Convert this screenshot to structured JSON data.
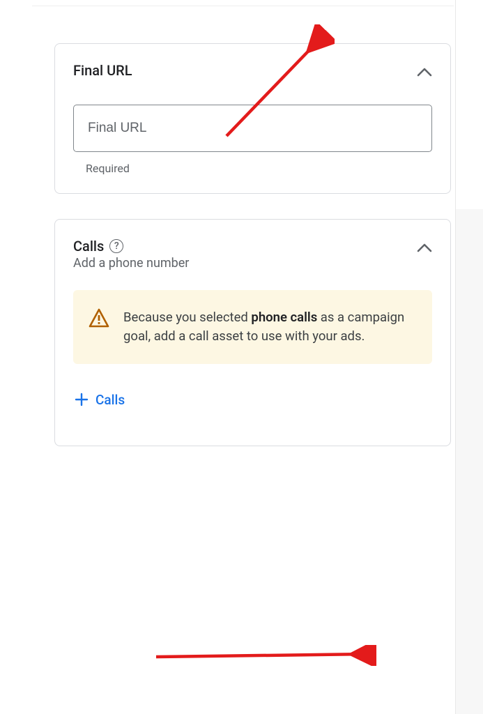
{
  "finalUrl": {
    "title": "Final URL",
    "placeholder": "Final URL",
    "helper": "Required"
  },
  "calls": {
    "title": "Calls",
    "subtitle": "Add a phone number",
    "alert_prefix": "Because you selected ",
    "alert_bold": "phone calls",
    "alert_suffix": " as a campaign goal, add a call asset to use with your ads.",
    "addLabel": "Calls"
  }
}
